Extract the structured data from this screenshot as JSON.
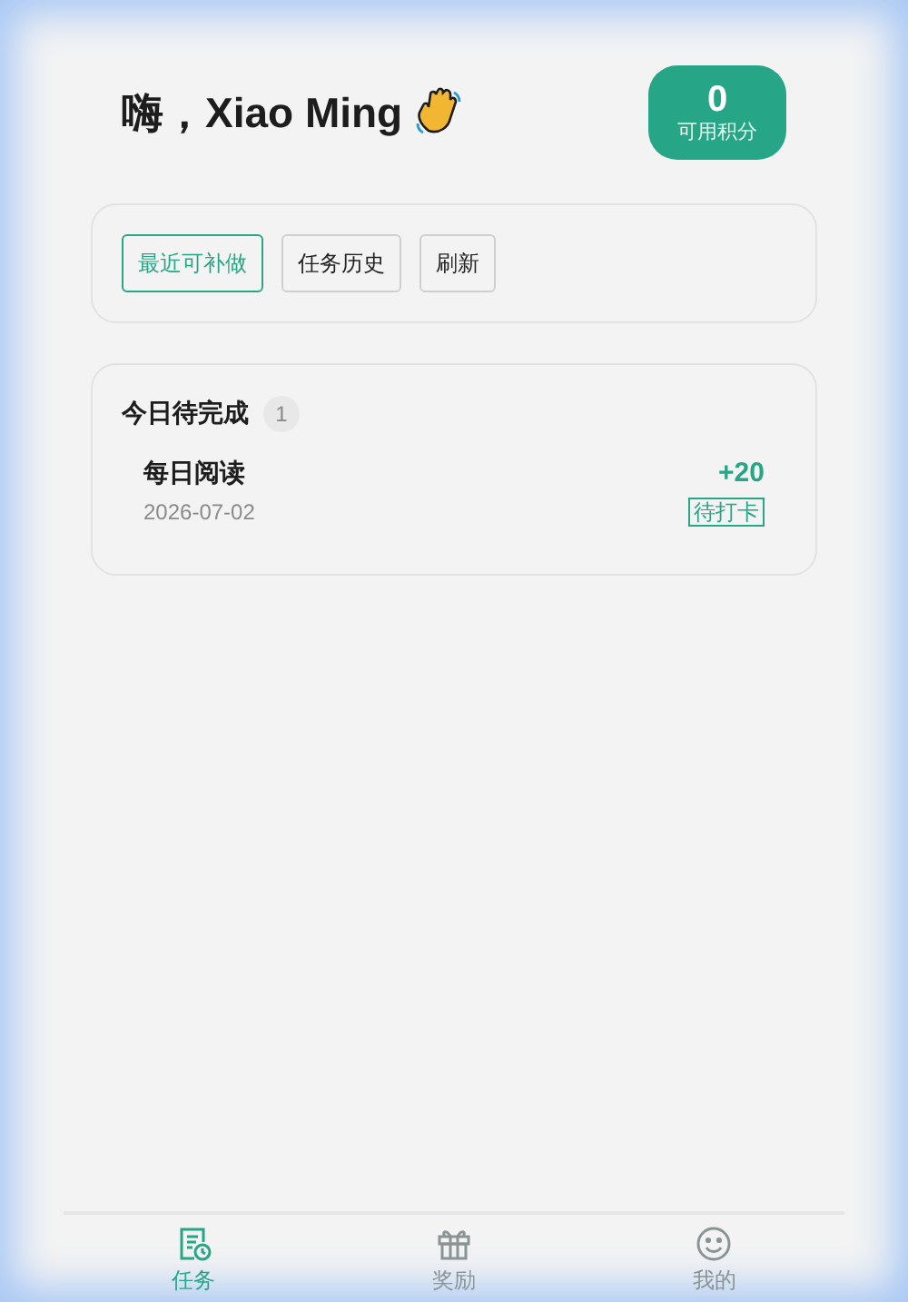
{
  "greeting": "嗨，Xiao Ming",
  "points": {
    "value": "0",
    "label": "可用积分"
  },
  "filters": [
    {
      "label": "最近可补做",
      "selected": true
    },
    {
      "label": "任务历史",
      "selected": false
    },
    {
      "label": "刷新",
      "selected": false
    }
  ],
  "today": {
    "title": "今日待完成",
    "count": "1",
    "tasks": [
      {
        "name": "每日阅读",
        "date": "2026-07-02",
        "reward": "+20",
        "status": "待打卡"
      }
    ]
  },
  "nav": [
    {
      "label": "任务",
      "kind": "tasks",
      "selected": true
    },
    {
      "label": "奖励",
      "kind": "gift",
      "selected": false
    },
    {
      "label": "我的",
      "kind": "smile",
      "selected": false
    }
  ]
}
